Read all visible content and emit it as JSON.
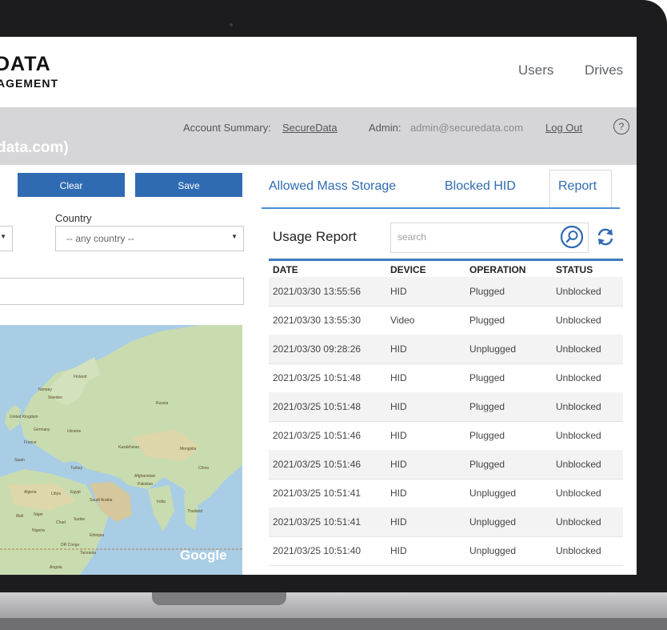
{
  "branding": {
    "line1": "DATA",
    "line2": "AGEMENT"
  },
  "nav": {
    "users": "Users",
    "drives": "Drives"
  },
  "account_bar": {
    "account_summary_label": "Account Summary:",
    "account_summary_link": "SecureData",
    "admin_label": "Admin:",
    "admin_value": "admin@securedata.com",
    "logout": "Log Out",
    "help": "?",
    "domain_fragment": "data.com)"
  },
  "left_panel": {
    "clear_button": "Clear",
    "save_button": "Save",
    "country_label": "Country",
    "country_select_value": "-- any country --",
    "map_attribution": "Google"
  },
  "tabs": {
    "allowed_mass_storage": "Allowed Mass Storage",
    "blocked_hid": "Blocked HID",
    "report": "Report"
  },
  "usage_report": {
    "title": "Usage Report",
    "search_placeholder": "search",
    "columns": [
      "DATE",
      "DEVICE",
      "OPERATION",
      "STATUS"
    ],
    "rows": [
      [
        "2021/03/30 13:55:56",
        "HID",
        "Plugged",
        "Unblocked"
      ],
      [
        "2021/03/30 13:55:30",
        "Video",
        "Plugged",
        "Unblocked"
      ],
      [
        "2021/03/30 09:28:26",
        "HID",
        "Unplugged",
        "Unblocked"
      ],
      [
        "2021/03/25 10:51:48",
        "HID",
        "Plugged",
        "Unblocked"
      ],
      [
        "2021/03/25 10:51:48",
        "HID",
        "Plugged",
        "Unblocked"
      ],
      [
        "2021/03/25 10:51:46",
        "HID",
        "Plugged",
        "Unblocked"
      ],
      [
        "2021/03/25 10:51:46",
        "HID",
        "Plugged",
        "Unblocked"
      ],
      [
        "2021/03/25 10:51:41",
        "HID",
        "Unplugged",
        "Unblocked"
      ],
      [
        "2021/03/25 10:51:41",
        "HID",
        "Unplugged",
        "Unblocked"
      ],
      [
        "2021/03/25 10:51:40",
        "HID",
        "Unplugged",
        "Unblocked"
      ]
    ]
  },
  "map_labels": [
    "Finland",
    "Norway",
    "Sweden",
    "Russia",
    "United Kingdom",
    "Germany",
    "Ukraine",
    "France",
    "Spain",
    "Turkey",
    "Kazakhstan",
    "Mongolia",
    "China",
    "Afghanistan",
    "Pakistan",
    "Algeria",
    "Libya",
    "Egypt",
    "Saudi Arabia",
    "India",
    "Thailand",
    "Mali",
    "Niger",
    "Chad",
    "Sudan",
    "Nigeria",
    "Ethiopia",
    "DR Congo",
    "Tanzania",
    "Angola"
  ],
  "colors": {
    "accent": "#2f6bb3",
    "tab_line": "#4b8fd6",
    "map_water": "#a9cde4",
    "map_land": "#c9dcb0"
  }
}
